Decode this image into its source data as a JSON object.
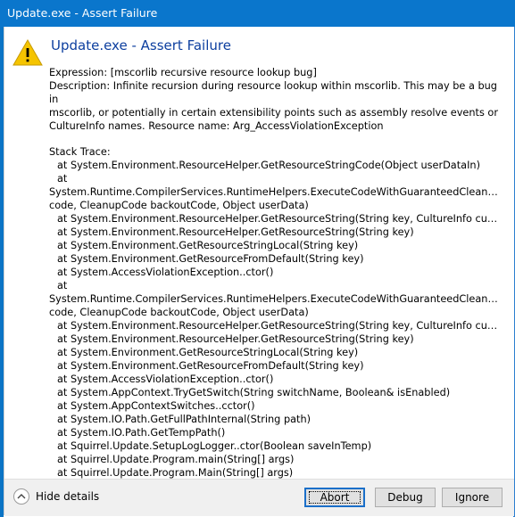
{
  "window": {
    "title": "Update.exe - Assert Failure"
  },
  "dialog": {
    "heading": "Update.exe - Assert Failure",
    "expression": "Expression: [mscorlib recursive resource lookup bug]",
    "description": [
      "Description: Infinite recursion during resource lookup within mscorlib.  This may be a bug in",
      "mscorlib, or potentially in certain extensibility points such as assembly resolve events or",
      "CultureInfo names.  Resource name: Arg_AccessViolationException"
    ],
    "stack_trace_header": "Stack Trace:",
    "stack_trace": [
      "   at System.Environment.ResourceHelper.GetResourceStringCode(Object userDataIn)",
      "   at",
      "System.Runtime.CompilerServices.RuntimeHelpers.ExecuteCodeWithGuaranteedCleanup(TryC...",
      "code, CleanupCode backoutCode, Object userData)",
      "   at System.Environment.ResourceHelper.GetResourceString(String key, CultureInfo culture)",
      "   at System.Environment.ResourceHelper.GetResourceString(String key)",
      "   at System.Environment.GetResourceStringLocal(String key)",
      "   at System.Environment.GetResourceFromDefault(String key)",
      "   at System.AccessViolationException..ctor()",
      "   at",
      "System.Runtime.CompilerServices.RuntimeHelpers.ExecuteCodeWithGuaranteedCleanup(TryC...",
      "code, CleanupCode backoutCode, Object userData)",
      "   at System.Environment.ResourceHelper.GetResourceString(String key, CultureInfo culture)",
      "   at System.Environment.ResourceHelper.GetResourceString(String key)",
      "   at System.Environment.GetResourceStringLocal(String key)",
      "   at System.Environment.GetResourceFromDefault(String key)",
      "   at System.AccessViolationException..ctor()",
      "   at System.AppContext.TryGetSwitch(String switchName, Boolean& isEnabled)",
      "   at System.AppContextSwitches..cctor()",
      "   at System.IO.Path.GetFullPathInternal(String path)",
      "   at System.IO.Path.GetTempPath()",
      "   at Squirrel.Update.SetupLogLogger..ctor(Boolean saveInTemp)",
      "   at Squirrel.Update.Program.main(String[] args)",
      "   at Squirrel.Update.Program.Main(String[] args)"
    ],
    "icons": {
      "warning": "warning-triangle-icon",
      "toggle": "chevron-up-icon"
    },
    "colors": {
      "titlebar": "#0a76cc",
      "heading": "#0d3f9f",
      "warning": "#f5c400",
      "footer": "#f0f0f0"
    }
  },
  "footer": {
    "hide_details": "Hide details",
    "abort": "Abort",
    "debug": "Debug",
    "ignore": "Ignore"
  }
}
